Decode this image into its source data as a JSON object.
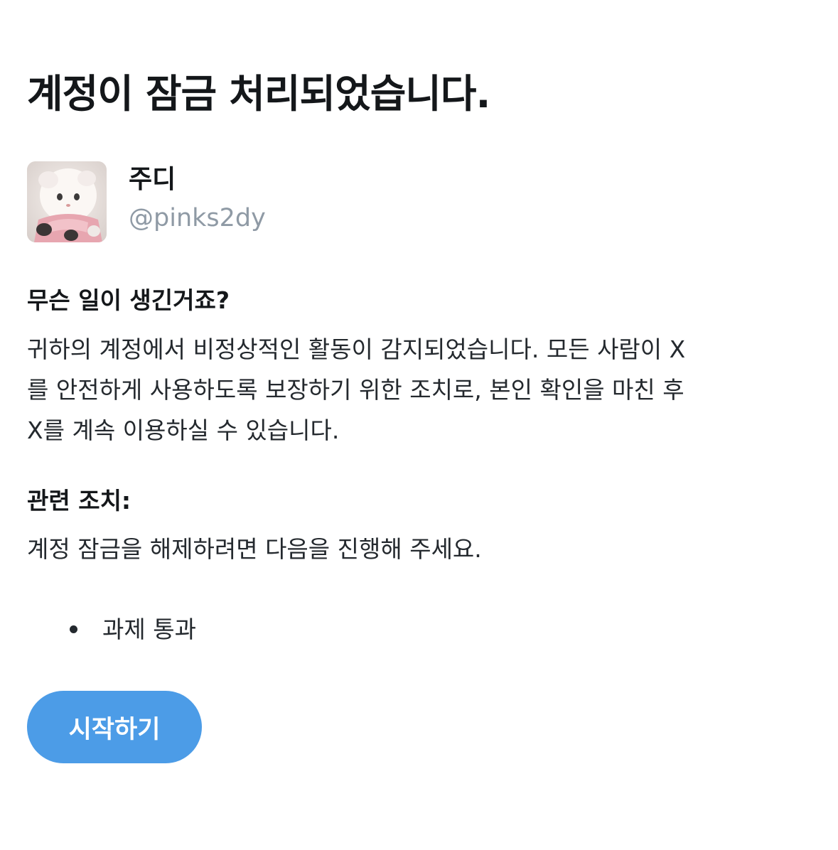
{
  "header": {
    "title": "계정이 잠금 처리되었습니다."
  },
  "profile": {
    "display_name": "주디",
    "handle": "@pinks2dy",
    "avatar_icon": "profile-photo"
  },
  "what_happened": {
    "heading": "무슨 일이 생긴거죠?",
    "lines": [
      "귀하의 계정에서 비정상적인 활동이 감지되었습니다. 모든 사람이 X",
      "를 안전하게 사용하도록 보장하기 위한 조치로, 본인 확인을 마친 후",
      "X를 계속 이용하실 수 있습니다."
    ]
  },
  "actions": {
    "heading": "관련 조치:",
    "description": "계정 잠금을 해제하려면 다음을 진행해 주세요.",
    "items": [
      "과제 통과"
    ]
  },
  "button": {
    "start_label": "시작하기"
  },
  "colors": {
    "accent": "#4c9ce7",
    "handle_text": "#8f9aa5",
    "text": "#14171a"
  }
}
